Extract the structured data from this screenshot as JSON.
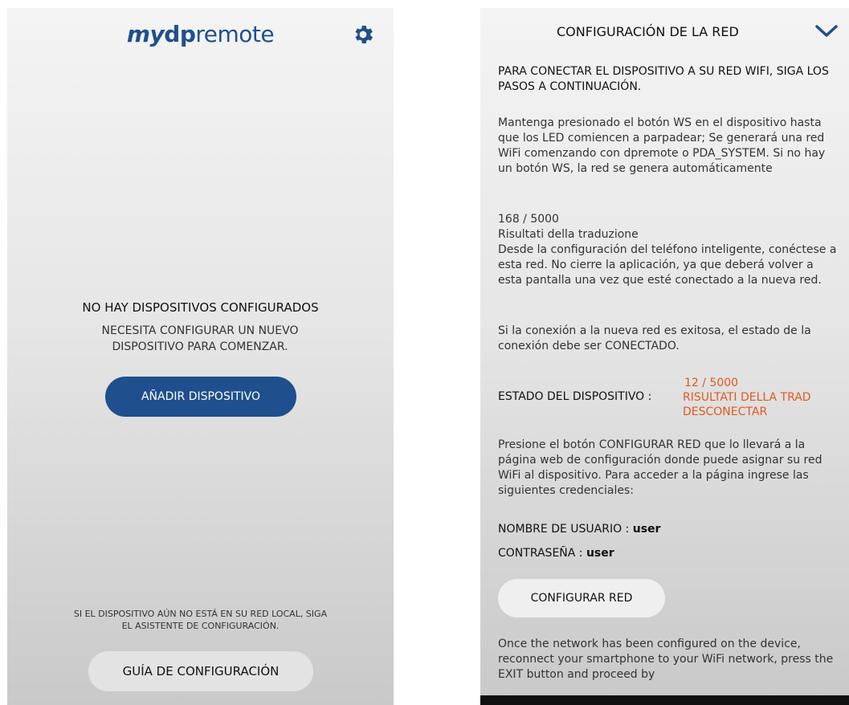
{
  "left": {
    "logo": {
      "my": "my",
      "dp": "dp",
      "remote": "remote"
    },
    "settings_icon": "gear-icon",
    "title": "NO HAY DISPOSITIVOS CONFIGURADOS",
    "subtitle_1": "NECESITA CONFIGURAR UN NUEVO",
    "subtitle_2": "DISPOSITIVO PARA COMENZAR.",
    "add_button": "AÑADIR DISPOSITIVO",
    "note_1": "SI EL DISPOSITIVO AÚN NO ESTÁ EN SU RED LOCAL, SIGA",
    "note_2": "EL ASISTENTE DE CONFIGURACIÓN.",
    "guide_button": "GUÍA DE CONFIGURACIÓN"
  },
  "right": {
    "title": "CONFIGURACIÓN DE LA RED",
    "collapse_icon": "chevron-down-icon",
    "intro": "PARA CONECTAR EL DISPOSITIVO A SU RED WIFI, SIGA LOS PASOS A CONTINUACIÓN.",
    "step1": "Mantenga presionado el botón WS en el dispositivo hasta que los LED comiencen a parpadear; Se generará una red WiFi comenzando con dpremote o PDA_SYSTEM. Si no hay un botón WS, la red se genera automáticamente",
    "counter": "168 / 5000",
    "translation_label": "Risultati della traduzione",
    "step2": "Desde la configuración del teléfono inteligente, conéctese a esta red. No cierre la aplicación, ya que deberá volver a esta pantalla una vez que esté conectado a la nueva red.",
    "step3": "Si la conexión a la nueva red es exitosa, el estado de la conexión debe ser CONECTADO.",
    "status_label": "ESTADO DEL DISPOSITIVO :",
    "status_counter": "12 / 5000",
    "status_line1": "RISULTATI DELLA TRAD",
    "status_line2": "DESCONECTAR",
    "step4": "Presione el botón CONFIGURAR RED que lo llevará a la página web de configuración donde puede asignar su red WiFi al dispositivo. Para acceder a la página ingrese las siguientes credenciales:",
    "username_label": "NOMBRE DE USUARIO :",
    "username_value": "user",
    "password_label": "CONTRASEÑA :",
    "password_value": "user",
    "configure_button": "CONFIGURAR RED",
    "step5": "Once the network has been configured on the device, reconnect your smartphone to your WiFi network, press the EXIT button and proceed by"
  },
  "colors": {
    "brand_blue": "#1f4f8c",
    "status_orange": "#e0581f"
  }
}
